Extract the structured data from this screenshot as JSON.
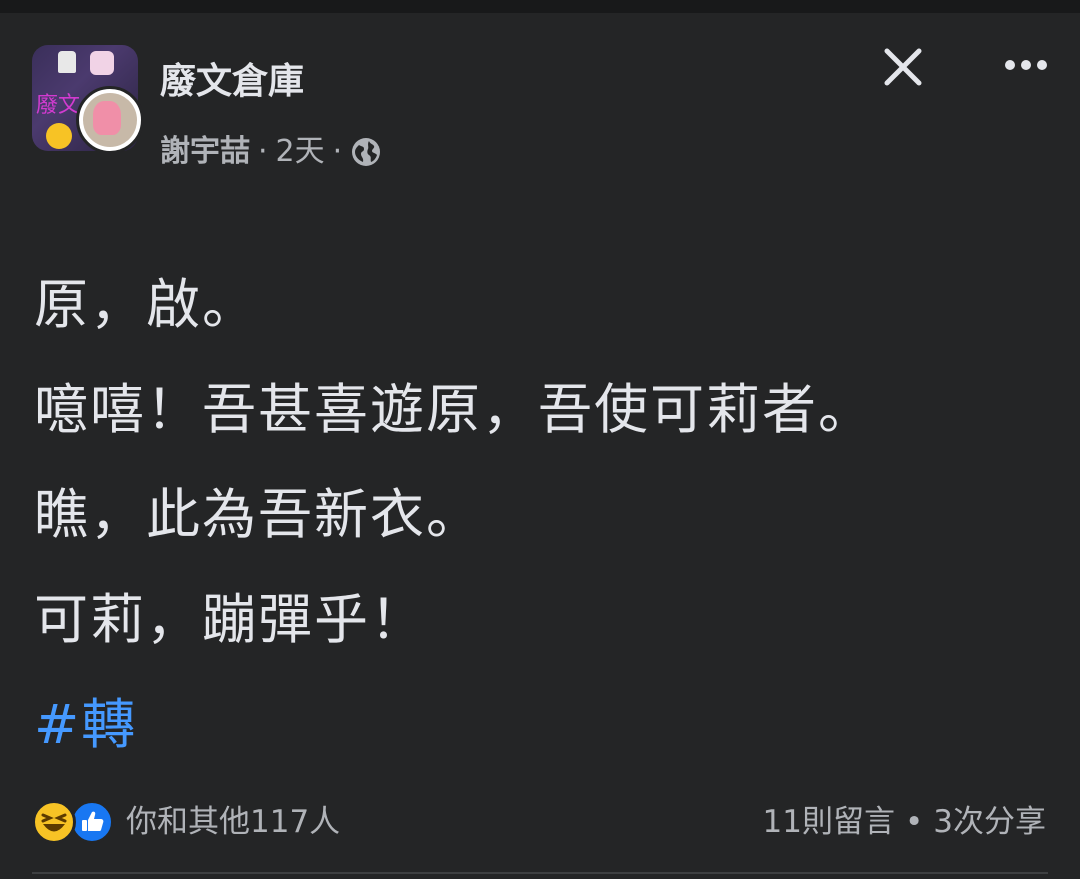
{
  "header": {
    "group_name": "廢文倉庫",
    "author": "謝宇喆",
    "separator": "·",
    "time": "2天",
    "privacy_icon": "globe-icon",
    "close_icon": "close-icon",
    "more_icon": "more-icon",
    "group_avatar_text": "廢文"
  },
  "post": {
    "lines": [
      "原，啟。",
      "噫嘻！吾甚喜遊原，吾使可莉者。",
      "瞧，此為吾新衣。",
      "可莉，蹦彈乎！"
    ],
    "hashtag": "#轉"
  },
  "footer": {
    "reaction_icons": [
      "haha-icon",
      "like-icon"
    ],
    "reaction_text": "你和其他117人",
    "comments": "11則留言",
    "dot": "•",
    "shares": "3次分享"
  },
  "colors": {
    "background": "#242526",
    "text": "#e4e6eb",
    "secondary_text": "#b0b3b8",
    "hashtag": "#4599ff",
    "like_blue": "#1877f2",
    "haha_yellow": "#f7c325"
  }
}
